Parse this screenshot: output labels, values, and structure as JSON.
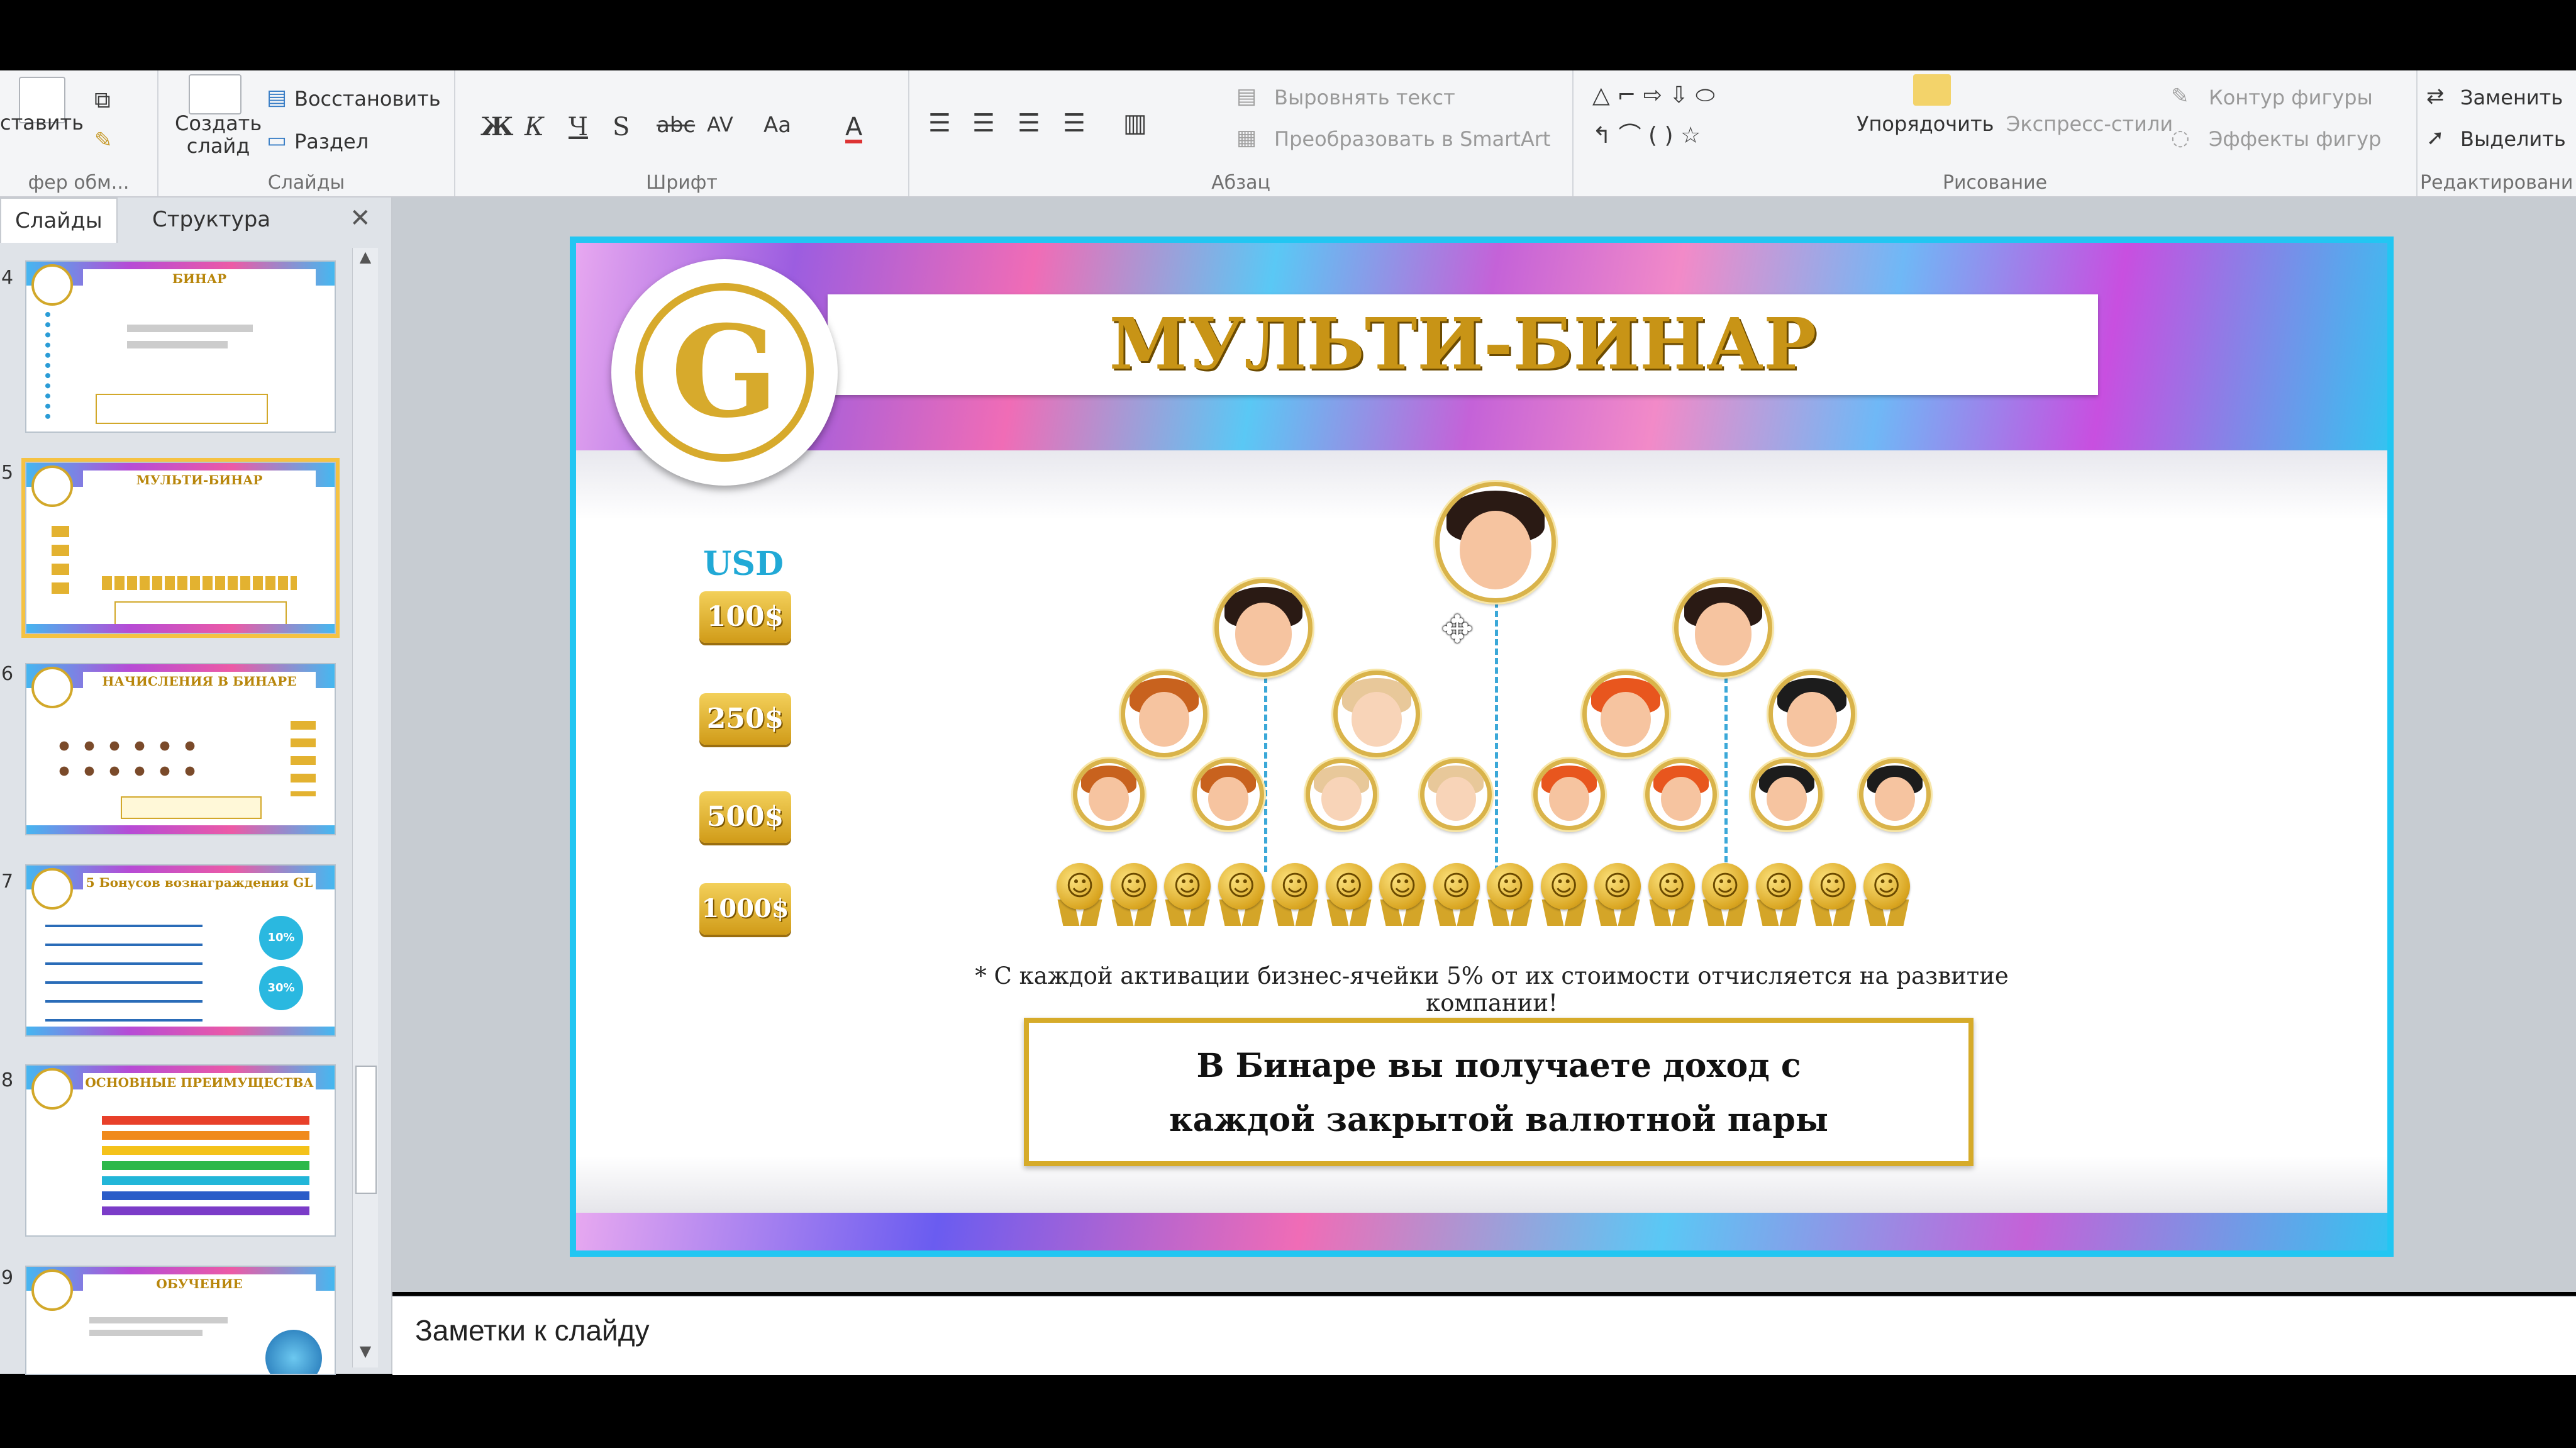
{
  "ribbon": {
    "clipboard": {
      "paste_label": "ставить",
      "group_label": "фер обм..."
    },
    "slides": {
      "create_label": "Создать\nслайд",
      "restore_label": "Восстановить",
      "section_label": "Раздел",
      "group_label": "Слайды"
    },
    "font": {
      "group_label": "Шрифт",
      "bold": "Ж",
      "italic": "К",
      "underline": "Ч",
      "shadow": "S",
      "strike": "abc",
      "spacing": "AV",
      "case": "Aa",
      "color": "A"
    },
    "paragraph": {
      "group_label": "Абзац",
      "align_text": "Выровнять текст",
      "smartart": "Преобразовать в SmartArt"
    },
    "drawing": {
      "group_label": "Рисование",
      "arrange": "Упорядочить",
      "quick_styles": "Экспресс-стили",
      "shape_outline": "Контур фигуры",
      "shape_effects": "Эффекты фигур"
    },
    "editing": {
      "group_label": "Редактировани",
      "replace": "Заменить",
      "select": "Выделить"
    }
  },
  "panel": {
    "tabs": [
      "Слайды",
      "Структура"
    ],
    "close": "✕",
    "thumbnails": [
      {
        "num": "4",
        "title": "БИНАР"
      },
      {
        "num": "5",
        "title": "МУЛЬТИ-БИНАР"
      },
      {
        "num": "6",
        "title": "НАЧИСЛЕНИЯ В БИНАРЕ"
      },
      {
        "num": "7",
        "title": "5 Бонусов вознаграждения GL"
      },
      {
        "num": "8",
        "title": "ОСНОВНЫЕ ПРЕИМУЩЕСТВА"
      },
      {
        "num": "9",
        "title": "ОБУЧЕНИЕ"
      }
    ],
    "thumb7_badges": [
      "10%",
      "30%"
    ]
  },
  "slide": {
    "title": "МУЛЬТИ-БИНАР",
    "currency_label": "USD",
    "prices": [
      "100$",
      "250$",
      "500$",
      "1000$"
    ],
    "footnote": "* С каждой активации бизнес-ячейки 5% от их стоимости отчисляется на развитие компании!",
    "box_line1": "В Бинаре вы получаете доход с",
    "box_line2": "каждой закрытой валютной пары",
    "medal_count": 16,
    "colors": {
      "border": "#22c6f2",
      "title_gold": "#b8860b",
      "price_gold": "#e3b230",
      "dashed_line": "#3ba8d8"
    }
  },
  "notes": {
    "placeholder": "Заметки к слайду"
  }
}
